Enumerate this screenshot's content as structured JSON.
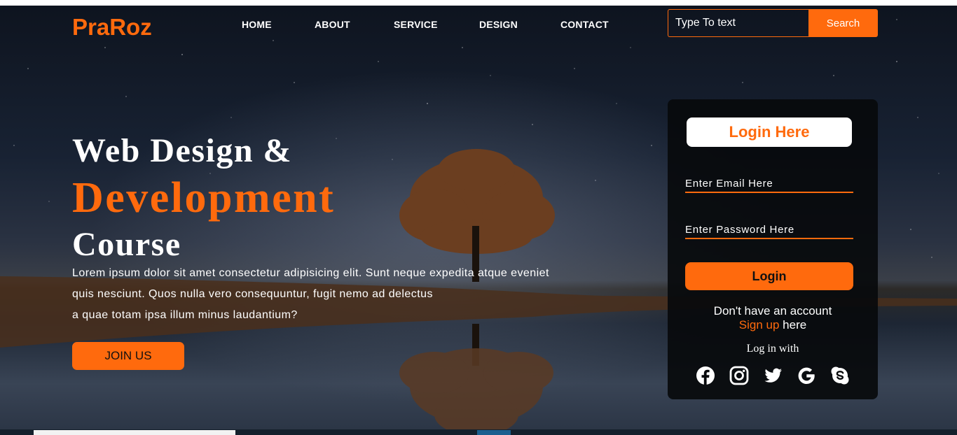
{
  "brand": {
    "logo": "PraRoz"
  },
  "nav": {
    "items": [
      "HOME",
      "ABOUT",
      "SERVICE",
      "DESIGN",
      "CONTACT"
    ]
  },
  "search": {
    "placeholder": "Type To text",
    "button_label": "Search"
  },
  "hero": {
    "line1": "Web Design &",
    "line2": "Development",
    "line3": "Course",
    "paragraph": [
      "Lorem ipsum dolor sit amet consectetur adipisicing elit. Sunt neque expedita atque eveniet",
      "quis nesciunt. Quos nulla vero consequuntur, fugit nemo ad delectus",
      "a quae totam ipsa illum minus laudantium?"
    ],
    "join_label": "JOIN US"
  },
  "login": {
    "title": "Login Here",
    "email_placeholder": "Enter Email Here",
    "password_placeholder": "Enter Password Here",
    "button_label": "Login",
    "no_account_text": "Don't have an account",
    "signup_link": "Sign up",
    "signup_suffix": " here",
    "login_with": "Log in with",
    "social_icons": [
      "facebook-icon",
      "instagram-icon",
      "twitter-icon",
      "google-icon",
      "skype-icon"
    ]
  },
  "colors": {
    "accent": "#ff6a0d",
    "panel": "#080a0c",
    "text": "#ffffff"
  }
}
